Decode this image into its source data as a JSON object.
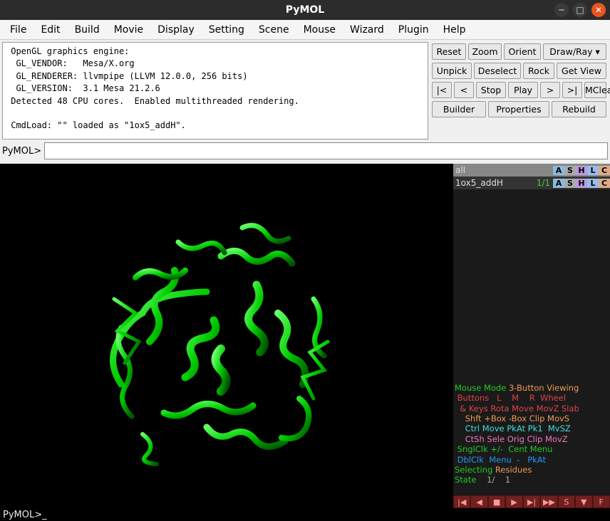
{
  "window": {
    "title": "PyMOL"
  },
  "menus": [
    "File",
    "Edit",
    "Build",
    "Movie",
    "Display",
    "Setting",
    "Scene",
    "Mouse",
    "Wizard",
    "Plugin",
    "Help"
  ],
  "console_text": " OpenGL graphics engine:\n  GL_VENDOR:   Mesa/X.org\n  GL_RENDERER: llvmpipe (LLVM 12.0.0, 256 bits)\n  GL_VERSION:  3.1 Mesa 21.2.6\n Detected 48 CPU cores.  Enabled multithreaded rendering.\n\n CmdLoad: \"\" loaded as \"1ox5_addH\".",
  "cmd_prompt": "PyMOL>",
  "cmd_value": "",
  "buttons": {
    "r1": [
      "Reset",
      "Zoom",
      "Orient",
      "Draw/Ray ▾"
    ],
    "r2": [
      "Unpick",
      "Deselect",
      "Rock",
      "Get View"
    ],
    "r3": [
      "|<",
      "<",
      "Stop",
      "Play",
      ">",
      ">|",
      "MClear"
    ],
    "r4": [
      "Builder",
      "Properties",
      "Rebuild"
    ]
  },
  "objects": [
    {
      "name": "all",
      "state": "",
      "sel": true
    },
    {
      "name": "1ox5_addH",
      "state": "1/1",
      "sel": false
    }
  ],
  "ashlc": [
    "A",
    "S",
    "H",
    "L",
    "C"
  ],
  "mouse_mode": {
    "title": [
      "Mouse Mode ",
      "3-Button Viewing"
    ],
    "hdr": " Buttons   L    M    R  Wheel",
    "keys": "  & Keys Rota Move MovZ Slab",
    "shft": "    Shft +Box -Box Clip MovS",
    "ctrl": "    Ctrl Move PkAt Pk1  MvSZ",
    "ctsh": "    CtSh Sele Orig Clip MovZ",
    "sngl": " SnglClk +/-  Cent Menu     ",
    "dbl": " DblClk  Menu  -   PkAt     ",
    "selecting": [
      "Selecting ",
      "Residues"
    ],
    "state": [
      "State ",
      "   1/    1"
    ]
  },
  "playback": [
    "|◀",
    "◀",
    "■",
    "▶",
    "▶|",
    "▶▶",
    "S",
    "▼",
    "F"
  ],
  "bottom_prompt": "PyMOL>"
}
